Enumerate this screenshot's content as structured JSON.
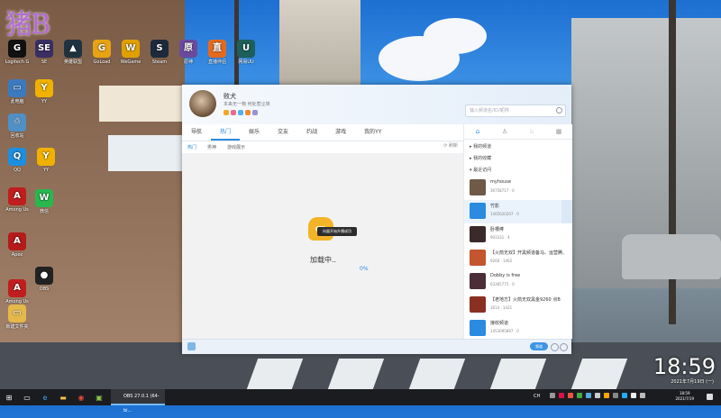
{
  "wallpaper": {
    "brand_text": "猪B"
  },
  "desktop_icons": [
    {
      "label": "Logitech G",
      "glyph": "G",
      "color": "#111111"
    },
    {
      "label": "SE",
      "glyph": "SE",
      "color": "#3a2e63"
    },
    {
      "label": "英雄联盟",
      "glyph": "▲",
      "color": "#1e3240"
    },
    {
      "label": "GoLoad",
      "glyph": "G",
      "color": "#e7a314"
    },
    {
      "label": "WeGame",
      "glyph": "W",
      "color": "#e0a000"
    },
    {
      "label": "Steam",
      "glyph": "S",
      "color": "#1c2a3c"
    },
    {
      "label": "原神",
      "glyph": "原",
      "color": "#6b4a9e"
    },
    {
      "label": "直播伴侣",
      "glyph": "直",
      "color": "#e66a1e"
    },
    {
      "label": "网易UU",
      "glyph": "U",
      "color": "#1d5f5a"
    },
    {
      "label": "此电脑",
      "glyph": "▭",
      "color": "#3c7ac0"
    },
    {
      "label": "回收站",
      "glyph": "♲",
      "color": "#4f90c7"
    },
    {
      "label": "QQ",
      "glyph": "Q",
      "color": "#1d8fe0"
    },
    {
      "label": "YY",
      "glyph": "Y",
      "color": "#f0b100"
    },
    {
      "label": "Among Us",
      "glyph": "A",
      "color": "#c01e1e"
    },
    {
      "label": "Apex",
      "glyph": "A",
      "color": "#b51b1b"
    },
    {
      "label": "Among Us",
      "glyph": "A",
      "color": "#c01e1e"
    },
    {
      "label": "新建文件夹",
      "glyph": "▭",
      "color": "#e5b84a"
    },
    {
      "label": "OBS",
      "glyph": "●",
      "color": "#222222"
    },
    {
      "label": "微信",
      "glyph": "W",
      "color": "#28b84e"
    },
    {
      "label": "YY",
      "glyph": "Y",
      "color": "#f0b100"
    }
  ],
  "app": {
    "user_name": "败犬",
    "user_sig": "本来无一物 何处惹尘埃",
    "badge_colors": [
      "#f5a623",
      "#e86a8f",
      "#4fb3ef",
      "#f08b2c",
      "#9b8fd6"
    ],
    "search_placeholder": "输入频道名/ID/昵称",
    "tabs": [
      "导航",
      "热门",
      "娱乐",
      "交友",
      "约战",
      "游戏",
      "我的YY"
    ],
    "active_tab": 1,
    "subtabs": [
      "热门",
      "男神",
      "游戏展示"
    ],
    "active_subtab": 0,
    "refresh_label": "刷新",
    "toast": "向量开始升播成功",
    "loading_text": "加载中..",
    "loading_progress": "0%",
    "side_tabs": [
      "⌂",
      "♙",
      "♘",
      "▦"
    ],
    "tree": [
      "我的频道",
      "我的收藏",
      "最近访问"
    ],
    "rooms": [
      {
        "title": "myhouse",
        "sub": "36758717  ·  0",
        "color": "#6f5a48"
      },
      {
        "title": "竹影",
        "sub": "1465620207  ·  0",
        "color": "#2b8be0"
      },
      {
        "title": "卧槽棒",
        "sub": "903331  ·  4",
        "color": "#3b2a2a"
      },
      {
        "title": "【火箭无双】开黑频道备马、运营腾、",
        "sub": "9260  ·  1462",
        "color": "#c4552e"
      },
      {
        "title": "Dobby is free",
        "sub": "63365775  ·  0",
        "color": "#4a2d36"
      },
      {
        "title": "【老地方】火箭无双黑金9260 点B",
        "sub": "1614  ·  1421",
        "color": "#8a2f22"
      },
      {
        "title": "接收频道",
        "sub": "1453095897  ·  0",
        "color": "#2b8be0"
      }
    ],
    "highlight_room": 1,
    "footer_button": "频道"
  },
  "clock": {
    "time": "18:59",
    "date": "2021年7月19日 (一)"
  },
  "taskbar": {
    "obs_label": "OBS 27.0.1 (64-bi...",
    "tray_time": "18:59",
    "tray_date": "2021/7/19",
    "ime": "CH"
  }
}
